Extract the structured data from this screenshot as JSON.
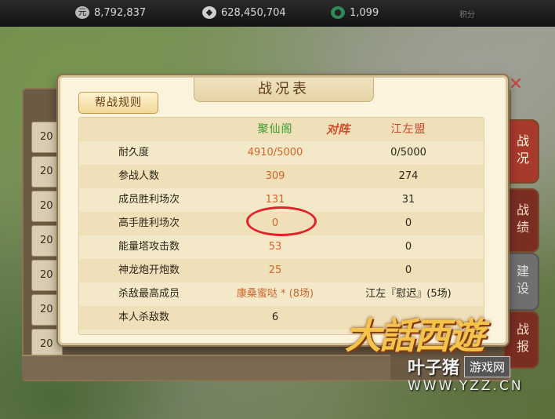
{
  "topbar": {
    "resources": [
      {
        "icon": "coin-icon",
        "value": "8,792,837"
      },
      {
        "icon": "silver-ingot-icon",
        "value": "628,450,704"
      },
      {
        "icon": "jade-icon",
        "value": "1,099"
      }
    ],
    "score_label": "积分"
  },
  "background_list": [
    "20",
    "20",
    "20",
    "20",
    "20",
    "20",
    "20"
  ],
  "side_tabs": [
    "战况",
    "战绩",
    "建设",
    "战报"
  ],
  "dialog": {
    "title": "战况表",
    "rules_button": "帮战规则",
    "header": {
      "left": "聚仙阁",
      "vs": "对阵",
      "right": "江左盟"
    },
    "rows": [
      {
        "label": "耐久度",
        "left": "4910/5000",
        "right": "0/5000"
      },
      {
        "label": "参战人数",
        "left": "309",
        "right": "274"
      },
      {
        "label": "成员胜利场次",
        "left": "131",
        "right": "31"
      },
      {
        "label": "高手胜利场次",
        "left": "0",
        "right": "0"
      },
      {
        "label": "能量塔攻击数",
        "left": "53",
        "right": "0"
      },
      {
        "label": "神龙炮开炮数",
        "left": "25",
        "right": "0"
      },
      {
        "label": "杀敌最高成员",
        "left": "康桑蜜哒 * (8场)",
        "right": "江左『慰迟』(5场)"
      },
      {
        "label": "本人杀敌数",
        "left": "6",
        "right": ""
      }
    ]
  },
  "watermark": {
    "logo": "大话西游",
    "site_name": "叶子猪",
    "site_tag": "游戏网",
    "url": "WWW.YZZ.CN"
  },
  "colors": {
    "accent_orange": "#d2652a",
    "header_green": "#3a9a2d",
    "header_red": "#c9452d",
    "highlight_red": "#e0222a"
  }
}
